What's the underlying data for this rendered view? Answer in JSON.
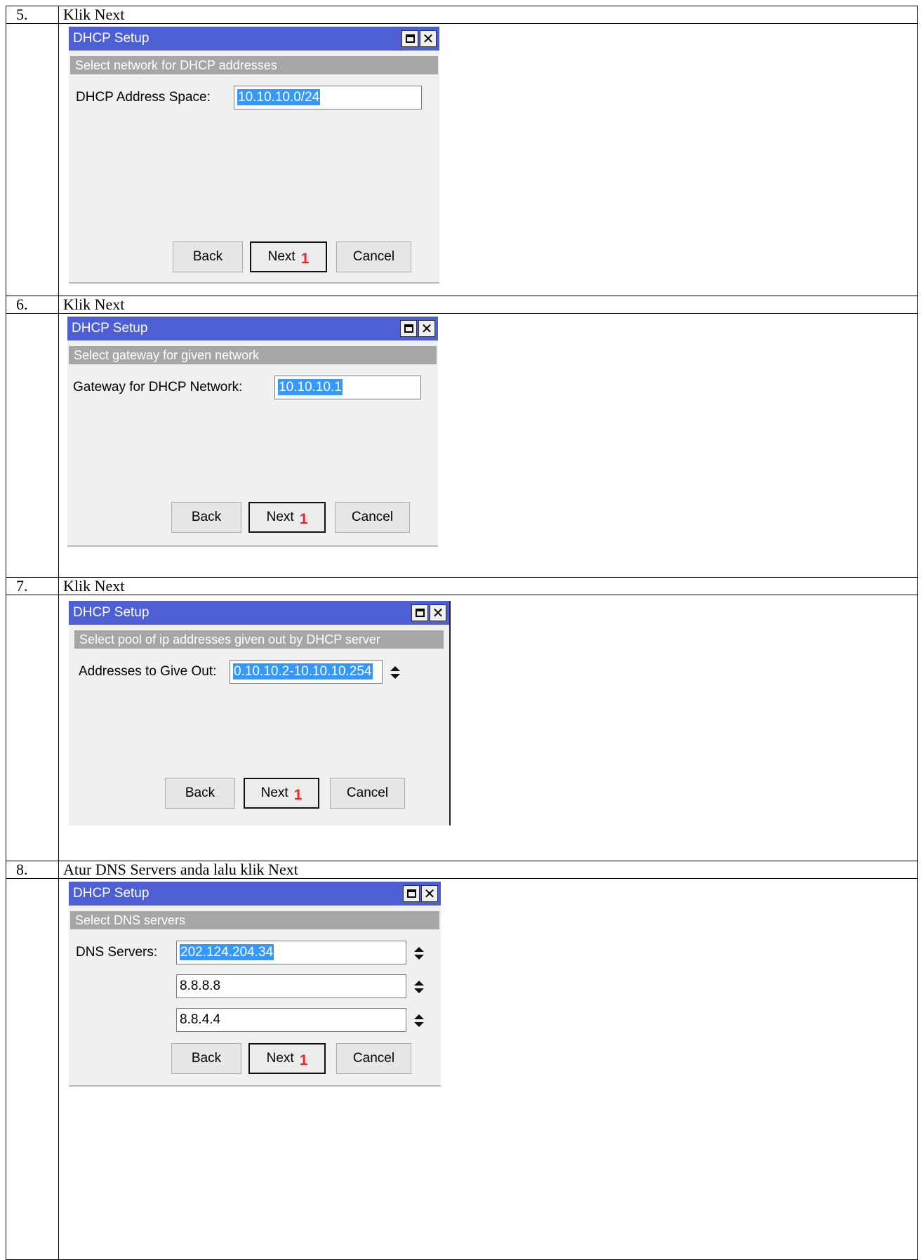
{
  "steps": [
    {
      "number": "5.",
      "instruction": "Klik Next",
      "dialog": {
        "title": "DHCP Setup",
        "section": "Select network for DHCP addresses",
        "fields": [
          {
            "label": "DHCP Address Space:",
            "value": "10.10.10.0/24",
            "selected": true
          }
        ],
        "buttons": {
          "back": "Back",
          "next": "Next",
          "cancel": "Cancel"
        },
        "marker": "1"
      }
    },
    {
      "number": "6.",
      "instruction": "Klik Next",
      "dialog": {
        "title": "DHCP Setup",
        "section": "Select gateway for given network",
        "fields": [
          {
            "label": "Gateway for DHCP Network:",
            "value": "10.10.10.1",
            "selected": true
          }
        ],
        "buttons": {
          "back": "Back",
          "next": "Next",
          "cancel": "Cancel"
        },
        "marker": "1"
      }
    },
    {
      "number": "7.",
      "instruction": "Klik Next",
      "dialog": {
        "title": "DHCP Setup",
        "section": "Select pool of ip addresses given out by DHCP server",
        "fields": [
          {
            "label": "Addresses to Give Out:",
            "value": "0.10.10.2-10.10.10.254",
            "selected": true
          }
        ],
        "buttons": {
          "back": "Back",
          "next": "Next",
          "cancel": "Cancel"
        },
        "marker": "1"
      }
    },
    {
      "number": "8.",
      "instruction": "Atur DNS Servers anda lalu klik Next",
      "dialog": {
        "title": "DHCP Setup",
        "section": "Select DNS servers",
        "fields": [
          {
            "label": "DNS Servers:",
            "value": "202.124.204.34",
            "selected": true
          },
          {
            "label": "",
            "value": "8.8.8.8",
            "selected": false
          },
          {
            "label": "",
            "value": "8.8.4.4",
            "selected": false
          }
        ],
        "buttons": {
          "back": "Back",
          "next": "Next",
          "cancel": "Cancel"
        },
        "marker": "1"
      }
    }
  ],
  "icons": {
    "maximize": "maximize-icon",
    "close": "close-icon",
    "spinner": "up-down-arrows-icon"
  },
  "colors": {
    "titlebar": "#4d5fd2",
    "section_bar": "#a6a6a6",
    "selection": "#3399ff",
    "marker": "#e5262b"
  }
}
